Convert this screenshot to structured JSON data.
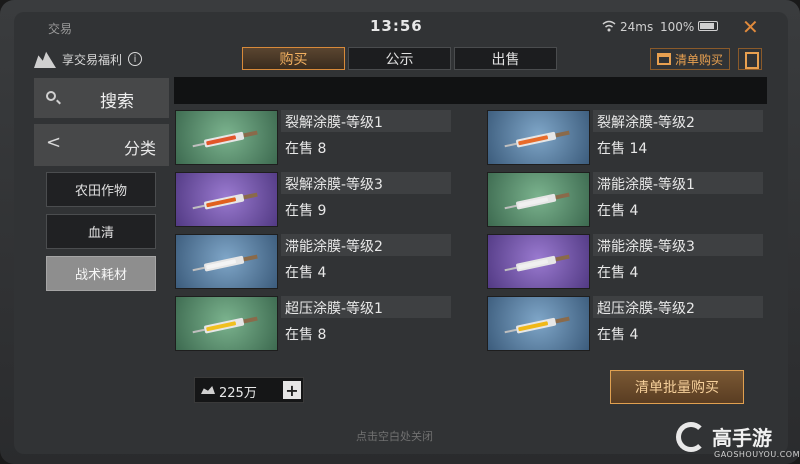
{
  "status": {
    "app_title": "交易",
    "clock": "13:56",
    "network": "24ms",
    "battery": "100%"
  },
  "perk": {
    "label": "享交易福利"
  },
  "tabs": [
    {
      "label": "购买",
      "active": true
    },
    {
      "label": "公示",
      "active": false
    },
    {
      "label": "出售",
      "active": false
    }
  ],
  "toolbar": {
    "cart_label": "清单购买"
  },
  "sidebar": {
    "search_label": "搜索",
    "category_label": "分类",
    "subcategories": [
      {
        "label": "农田作物",
        "active": false
      },
      {
        "label": "血清",
        "active": false
      },
      {
        "label": "战术耗材",
        "active": true
      }
    ]
  },
  "items": [
    {
      "name": "裂解涂膜-等级1",
      "stock": "在售 8",
      "bg": "green",
      "fluid": "#e2552a"
    },
    {
      "name": "裂解涂膜-等级2",
      "stock": "在售 14",
      "bg": "blue",
      "fluid": "#e86b2a"
    },
    {
      "name": "裂解涂膜-等级3",
      "stock": "在售 9",
      "bg": "purple",
      "fluid": "#e0601e"
    },
    {
      "name": "滞能涂膜-等级1",
      "stock": "在售 4",
      "bg": "green",
      "fluid": "#f0f0f0"
    },
    {
      "name": "滞能涂膜-等级2",
      "stock": "在售 4",
      "bg": "blue",
      "fluid": "#f4f4f4"
    },
    {
      "name": "滞能涂膜-等级3",
      "stock": "在售 4",
      "bg": "purple",
      "fluid": "#f0f0f0"
    },
    {
      "name": "超压涂膜-等级1",
      "stock": "在售 8",
      "bg": "green",
      "fluid": "#f0c020"
    },
    {
      "name": "超压涂膜-等级2",
      "stock": "在售 4",
      "bg": "blue",
      "fluid": "#f0b818"
    }
  ],
  "wallet": {
    "amount": "225万"
  },
  "actions": {
    "bulk_buy_label": "清单批量购买"
  },
  "hint": "点击空白处关闭",
  "watermark": {
    "name": "高手游",
    "domain": "GAOSHOUYOU.COM"
  }
}
